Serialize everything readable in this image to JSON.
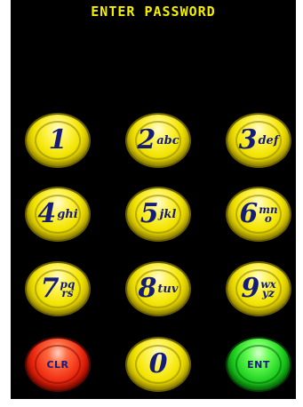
{
  "prompt": "ENTER PASSWORD",
  "colors": {
    "background": "#000000",
    "prompt_text": "#f4f000",
    "key_yellow": "#f2e400",
    "key_red": "#ee2a10",
    "key_green": "#20d020",
    "key_text": "#141c78"
  },
  "keys": {
    "k1": {
      "digit": "1",
      "letters": ""
    },
    "k2": {
      "digit": "2",
      "letters": "abc"
    },
    "k3": {
      "digit": "3",
      "letters": "def"
    },
    "k4": {
      "digit": "4",
      "letters": "ghi"
    },
    "k5": {
      "digit": "5",
      "letters": "jkl"
    },
    "k6": {
      "digit": "6",
      "letters_top": "mn",
      "letters_bottom": "o"
    },
    "k7": {
      "digit": "7",
      "letters_top": "pq",
      "letters_bottom": "rs"
    },
    "k8": {
      "digit": "8",
      "letters": "tuv"
    },
    "k9": {
      "digit": "9",
      "letters_top": "wx",
      "letters_bottom": "yz"
    },
    "k0": {
      "digit": "0"
    },
    "clear": {
      "label": "CLR"
    },
    "enter": {
      "label": "ENT"
    }
  }
}
